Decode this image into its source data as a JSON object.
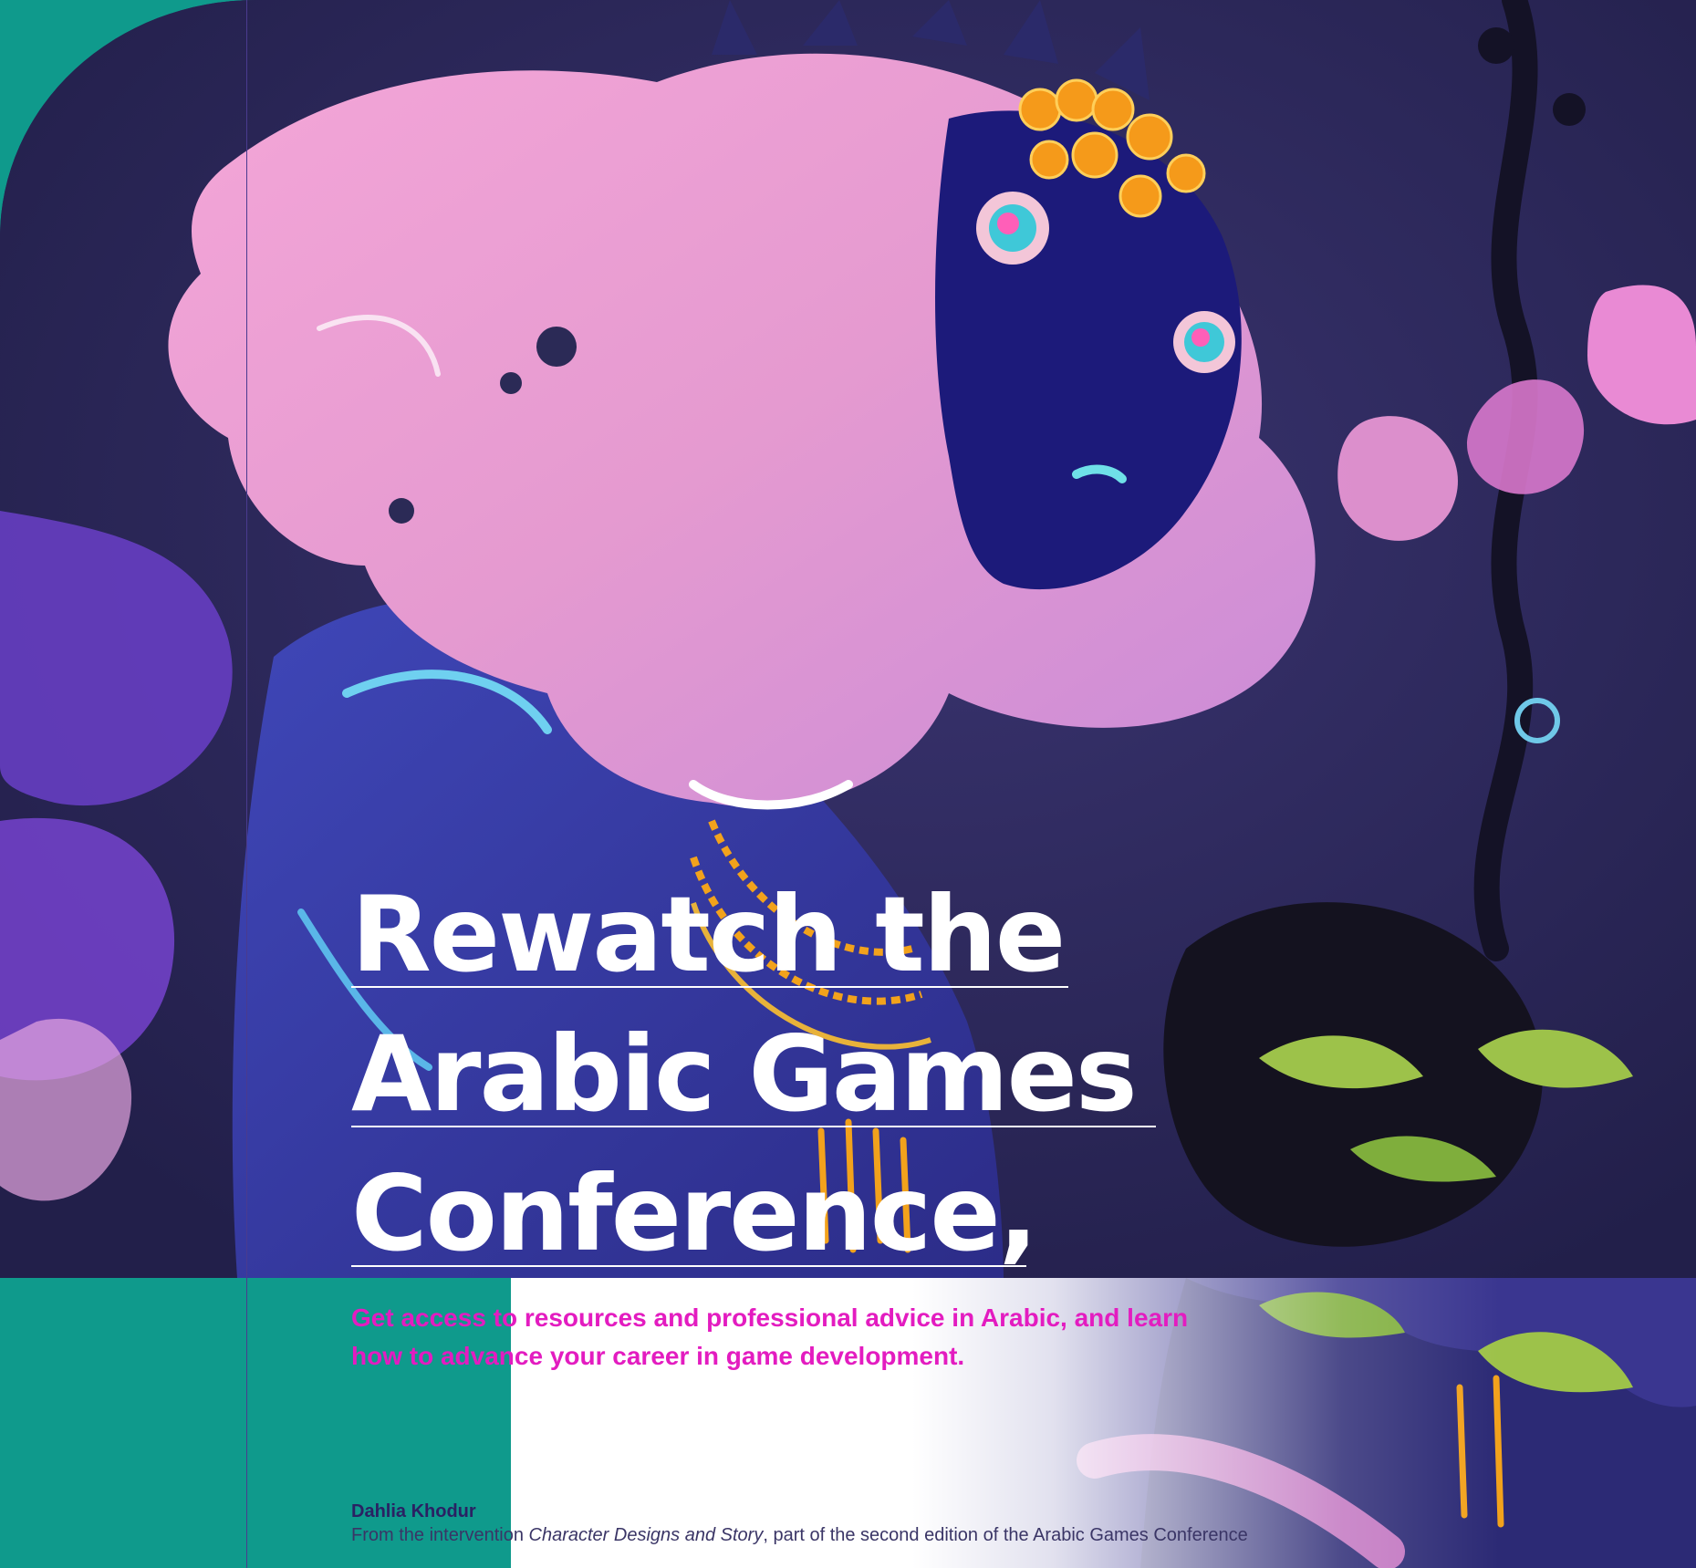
{
  "article": {
    "title_lines": [
      "Rewatch the",
      "Arabic Games",
      "Conference,"
    ],
    "subtitle": "Get access to resources and professional advice in Arabic, and learn how to advance your career in game development.",
    "author": "Dahlia Khodur",
    "caption": {
      "prefix": "From the intervention ",
      "work": "Character Designs and Story",
      "suffix": ", part of the second edition of the Arabic Games Conference"
    }
  },
  "colors": {
    "teal": "#0f9a8c",
    "magenta": "#e31cc0",
    "navy": "#2a2163",
    "art_background": "#2a2856"
  }
}
